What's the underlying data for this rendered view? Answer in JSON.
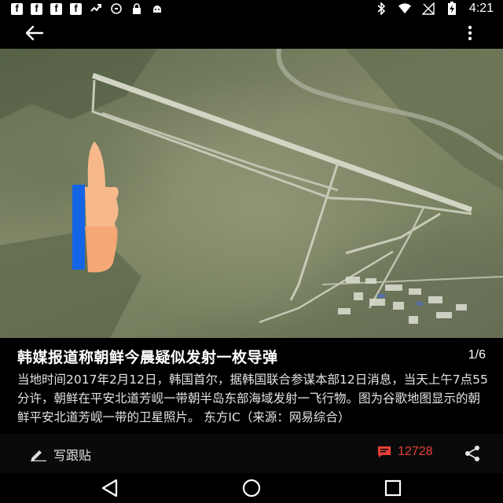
{
  "status_bar": {
    "left_icons": [
      "facebook-icon",
      "facebook-icon",
      "facebook-icon",
      "facebook-icon",
      "missed-call-icon",
      "sync-icon",
      "lock-icon",
      "android-icon"
    ],
    "right_icons": [
      "bluetooth-icon",
      "wifi-icon",
      "signal-icon",
      "battery-charging-icon"
    ],
    "time": "4:21"
  },
  "app_bar": {
    "back_icon": "arrow-back-icon",
    "menu_icon": "more-vert-icon"
  },
  "caption": {
    "title": "韩媒报道称朝鲜今晨疑似发射一枚导弹",
    "counter": "1/6",
    "body": "当地时间2017年2月12日，韩国首尔，据韩国联合参谋本部12日消息，当天上午7点55分许，朝鲜在平安北道芳岘一带朝半岛东部海域发射一飞行物。图为谷歌地图显示的朝鲜平安北道芳岘一带的卫星照片。  东方IC（来源：网易综合）"
  },
  "actions": {
    "write_label": "写跟贴",
    "comment_count": "12728",
    "accent_color": "#e8403a"
  },
  "nav": {
    "icons": [
      "back-triangle-icon",
      "home-circle-icon",
      "recents-square-icon"
    ]
  }
}
